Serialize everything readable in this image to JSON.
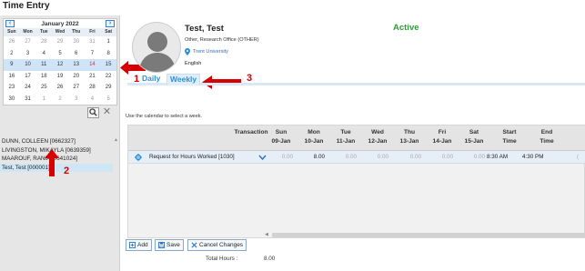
{
  "page": {
    "title": "Time Entry"
  },
  "calendar": {
    "month_label": "January 2022",
    "prev_label": "<",
    "next_label": ">",
    "weekdays": [
      "Sun",
      "Mon",
      "Tue",
      "Wed",
      "Thu",
      "Fri",
      "Sat"
    ],
    "weeks": [
      [
        "26",
        "27",
        "28",
        "29",
        "30",
        "31",
        "1"
      ],
      [
        "2",
        "3",
        "4",
        "5",
        "6",
        "7",
        "8"
      ],
      [
        "9",
        "10",
        "11",
        "12",
        "13",
        "14",
        "15"
      ],
      [
        "16",
        "17",
        "18",
        "19",
        "20",
        "21",
        "22"
      ],
      [
        "23",
        "24",
        "25",
        "26",
        "27",
        "28",
        "29"
      ],
      [
        "30",
        "31",
        "1",
        "2",
        "3",
        "4",
        "5"
      ]
    ],
    "selected_week_index": 2,
    "today_label": "14"
  },
  "search": {
    "search_icon": "search-icon",
    "clear_icon": "close-icon"
  },
  "employees": [
    {
      "label": "DUNN, COLLEEN [0662327]",
      "selected": false
    },
    {
      "label": "LIVINGSTON, MIKAYLA [0639359]",
      "selected": false
    },
    {
      "label": "MAAROUF, RANIA [0641024]",
      "selected": false
    },
    {
      "label": "Test, Test [000001]",
      "selected": true
    }
  ],
  "annotations": {
    "n1": "1",
    "n2": "2",
    "n3": "3",
    "color": "#d60000"
  },
  "employee": {
    "name": "Test, Test",
    "status": "Active",
    "department": "Other, Research Office (OTHER)",
    "organization": "Trent University",
    "language": "English"
  },
  "tabs": {
    "daily": "Daily",
    "weekly": "Weekly"
  },
  "instruction": "Use the calendar to select a week.",
  "grid": {
    "columns": [
      {
        "l1": "Transaction",
        "l2": ""
      },
      {
        "l1": "Sun",
        "l2": "09-Jan"
      },
      {
        "l1": "Mon",
        "l2": "10-Jan"
      },
      {
        "l1": "Tue",
        "l2": "11-Jan"
      },
      {
        "l1": "Wed",
        "l2": "12-Jan"
      },
      {
        "l1": "Thu",
        "l2": "13-Jan"
      },
      {
        "l1": "Fri",
        "l2": "14-Jan"
      },
      {
        "l1": "Sat",
        "l2": "15-Jan"
      },
      {
        "l1": "Start",
        "l2": "Time"
      },
      {
        "l1": "End",
        "l2": "Time"
      }
    ],
    "row": {
      "transaction": "Request for Hours Worked [1030]",
      "values": [
        "0.00",
        "8.00",
        "0.00",
        "0.00",
        "0.00",
        "0.00",
        "0.00"
      ],
      "start": "8:30 AM",
      "end": "4:30 PM",
      "extra": "("
    }
  },
  "buttons": {
    "add": "Add",
    "save": "Save",
    "cancel": "Cancel Changes"
  },
  "totals": {
    "label": "Total Hours :",
    "value": "8.00"
  },
  "colors": {
    "accent": "#2f8fd8",
    "status_active": "#2e9b3a",
    "selection": "#cfe6f7"
  }
}
